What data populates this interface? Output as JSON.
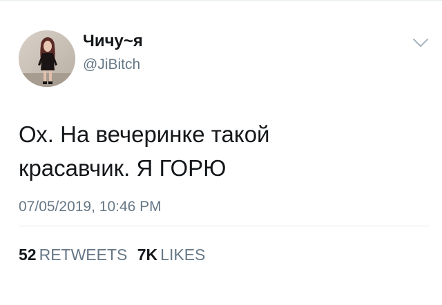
{
  "user": {
    "display_name": "Чичу~я",
    "handle": "@JiBitch"
  },
  "tweet": {
    "text_lines": [
      "Ох. На вечеринке такой",
      "красавчик. Я ГОРЮ"
    ],
    "timestamp": "07/05/2019, 10:46 PM"
  },
  "stats": {
    "retweets_count": "52",
    "retweets_label": "RETWEETS",
    "likes_count": "7K",
    "likes_label": "LIKES"
  },
  "icons": {
    "avatar": "profile-photo",
    "menu": "chevron-down-icon"
  },
  "colors": {
    "text_primary": "#14171a",
    "text_secondary": "#657786",
    "divider": "#e1e8ed"
  }
}
